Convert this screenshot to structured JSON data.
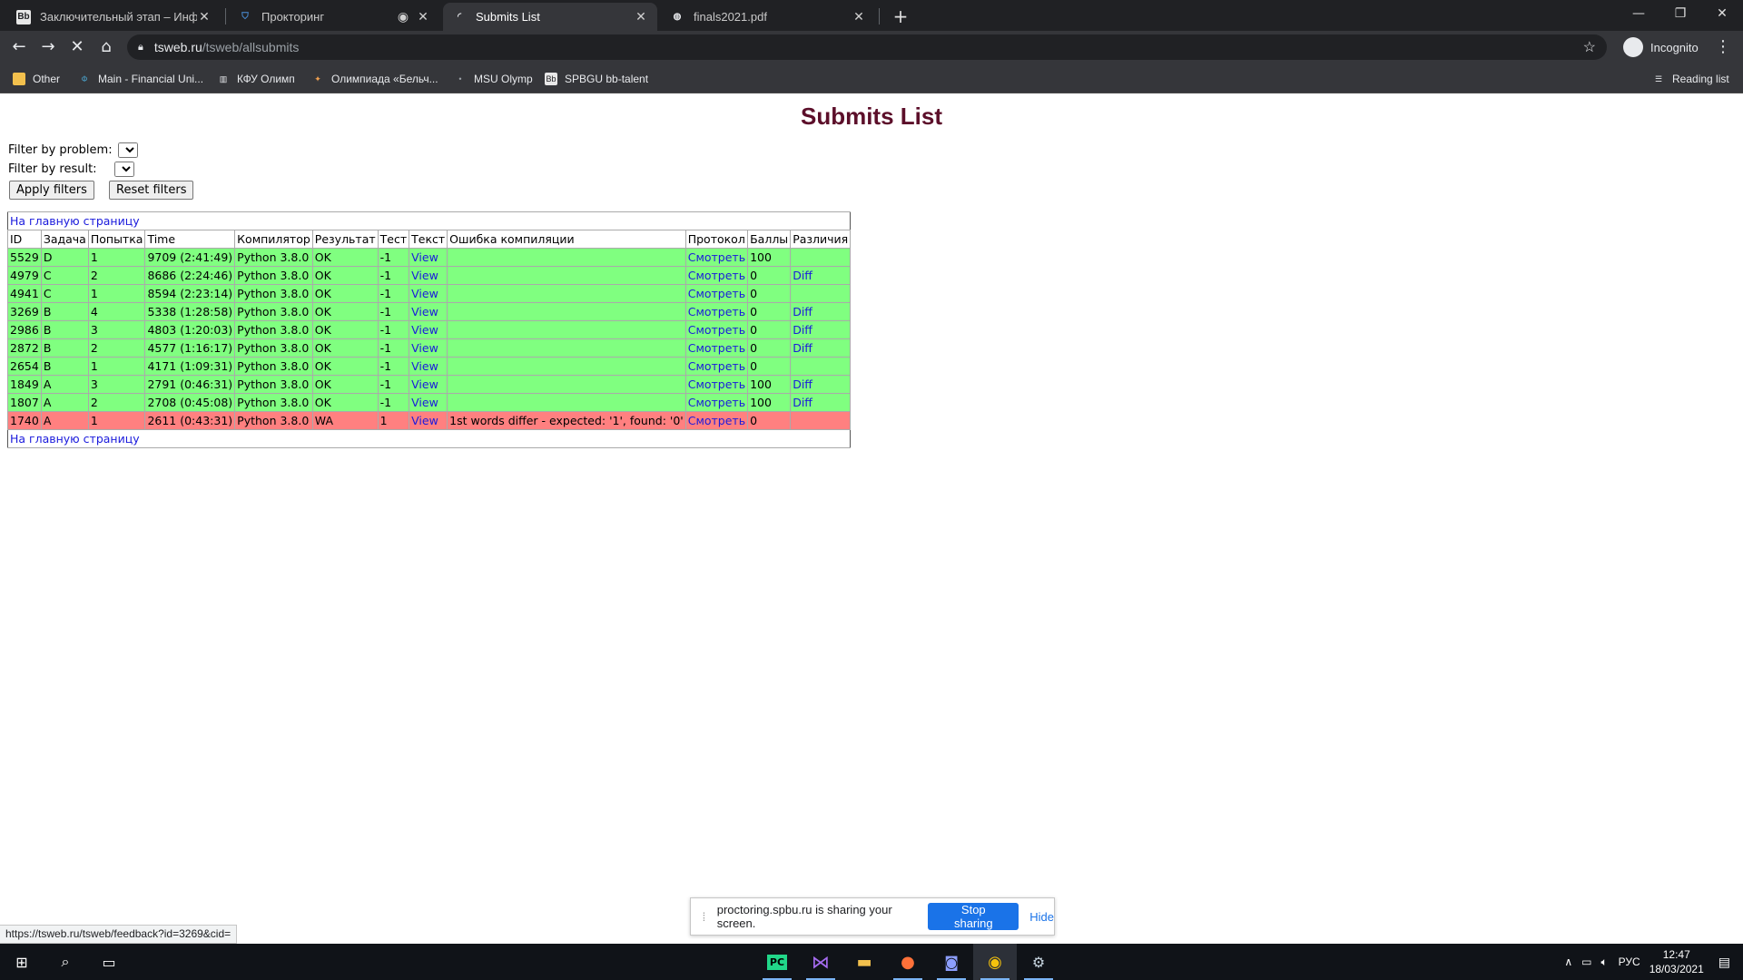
{
  "browser": {
    "tabs": [
      {
        "title": "Заключительный этап – Инфор",
        "favicon": "Bb"
      },
      {
        "title": "Прокторинг",
        "favicon": "shield"
      },
      {
        "title": "Submits List",
        "favicon": "loading"
      },
      {
        "title": "finals2021.pdf",
        "favicon": "globe"
      }
    ],
    "url_host": "tsweb.ru",
    "url_path": "/tsweb/allsubmits",
    "profile_label": "Incognito",
    "reading_list": "Reading list",
    "bookmarks": [
      {
        "label": "Other"
      },
      {
        "label": "Main - Financial Uni..."
      },
      {
        "label": "КФУ Олимп"
      },
      {
        "label": "Олимпиада «Бельч..."
      },
      {
        "label": "MSU Olymp"
      },
      {
        "label": "SPBGU bb-talent"
      }
    ]
  },
  "page": {
    "title": "Submits List",
    "filter_problem_label": "Filter by problem:",
    "filter_result_label": "Filter by result:",
    "apply_filters": "Apply filters",
    "reset_filters": "Reset filters",
    "home_link": "На главную страницу",
    "columns": [
      "ID",
      "Задача",
      "Попытка",
      "Time",
      "Компилятор",
      "Результат",
      "Тест",
      "Текст",
      "Ошибка компиляции",
      "Протокол",
      "Баллы",
      "Различия"
    ],
    "view_label": "View",
    "protocol_label": "Смотреть",
    "diff_label": "Diff",
    "rows": [
      {
        "id": "5529",
        "task": "D",
        "attempt": "1",
        "time": "9709 (2:41:49)",
        "compiler": "Python 3.8.0",
        "result": "OK",
        "test": "-1",
        "error": "",
        "points": "100",
        "diff": false,
        "status": "ok"
      },
      {
        "id": "4979",
        "task": "C",
        "attempt": "2",
        "time": "8686 (2:24:46)",
        "compiler": "Python 3.8.0",
        "result": "OK",
        "test": "-1",
        "error": "",
        "points": "0",
        "diff": true,
        "status": "ok"
      },
      {
        "id": "4941",
        "task": "C",
        "attempt": "1",
        "time": "8594 (2:23:14)",
        "compiler": "Python 3.8.0",
        "result": "OK",
        "test": "-1",
        "error": "",
        "points": "0",
        "diff": false,
        "status": "ok"
      },
      {
        "id": "3269",
        "task": "B",
        "attempt": "4",
        "time": "5338 (1:28:58)",
        "compiler": "Python 3.8.0",
        "result": "OK",
        "test": "-1",
        "error": "",
        "points": "0",
        "diff": true,
        "status": "ok"
      },
      {
        "id": "2986",
        "task": "B",
        "attempt": "3",
        "time": "4803 (1:20:03)",
        "compiler": "Python 3.8.0",
        "result": "OK",
        "test": "-1",
        "error": "",
        "points": "0",
        "diff": true,
        "status": "ok"
      },
      {
        "id": "2872",
        "task": "B",
        "attempt": "2",
        "time": "4577 (1:16:17)",
        "compiler": "Python 3.8.0",
        "result": "OK",
        "test": "-1",
        "error": "",
        "points": "0",
        "diff": true,
        "status": "ok"
      },
      {
        "id": "2654",
        "task": "B",
        "attempt": "1",
        "time": "4171 (1:09:31)",
        "compiler": "Python 3.8.0",
        "result": "OK",
        "test": "-1",
        "error": "",
        "points": "0",
        "diff": false,
        "status": "ok"
      },
      {
        "id": "1849",
        "task": "A",
        "attempt": "3",
        "time": "2791 (0:46:31)",
        "compiler": "Python 3.8.0",
        "result": "OK",
        "test": "-1",
        "error": "",
        "points": "100",
        "diff": true,
        "status": "ok"
      },
      {
        "id": "1807",
        "task": "A",
        "attempt": "2",
        "time": "2708 (0:45:08)",
        "compiler": "Python 3.8.0",
        "result": "OK",
        "test": "-1",
        "error": "",
        "points": "100",
        "diff": true,
        "status": "ok"
      },
      {
        "id": "1740",
        "task": "A",
        "attempt": "1",
        "time": "2611 (0:43:31)",
        "compiler": "Python 3.8.0",
        "result": "WA",
        "test": "1",
        "error": "1st words differ - expected: '1', found: '0'",
        "points": "0",
        "diff": false,
        "status": "wa"
      }
    ],
    "colors": {
      "ok": "#80ff80",
      "wa": "#ff8080",
      "title": "#5c0f2a",
      "link": "#1a1adc"
    }
  },
  "share_bar": {
    "message": "proctoring.spbu.ru is sharing your screen.",
    "stop_label": "Stop sharing",
    "hide_label": "Hide"
  },
  "status_url": "https://tsweb.ru/tsweb/feedback?id=3269&cid=",
  "taskbar": {
    "lang": "РУС",
    "time": "12:47",
    "date": "18/03/2021"
  }
}
